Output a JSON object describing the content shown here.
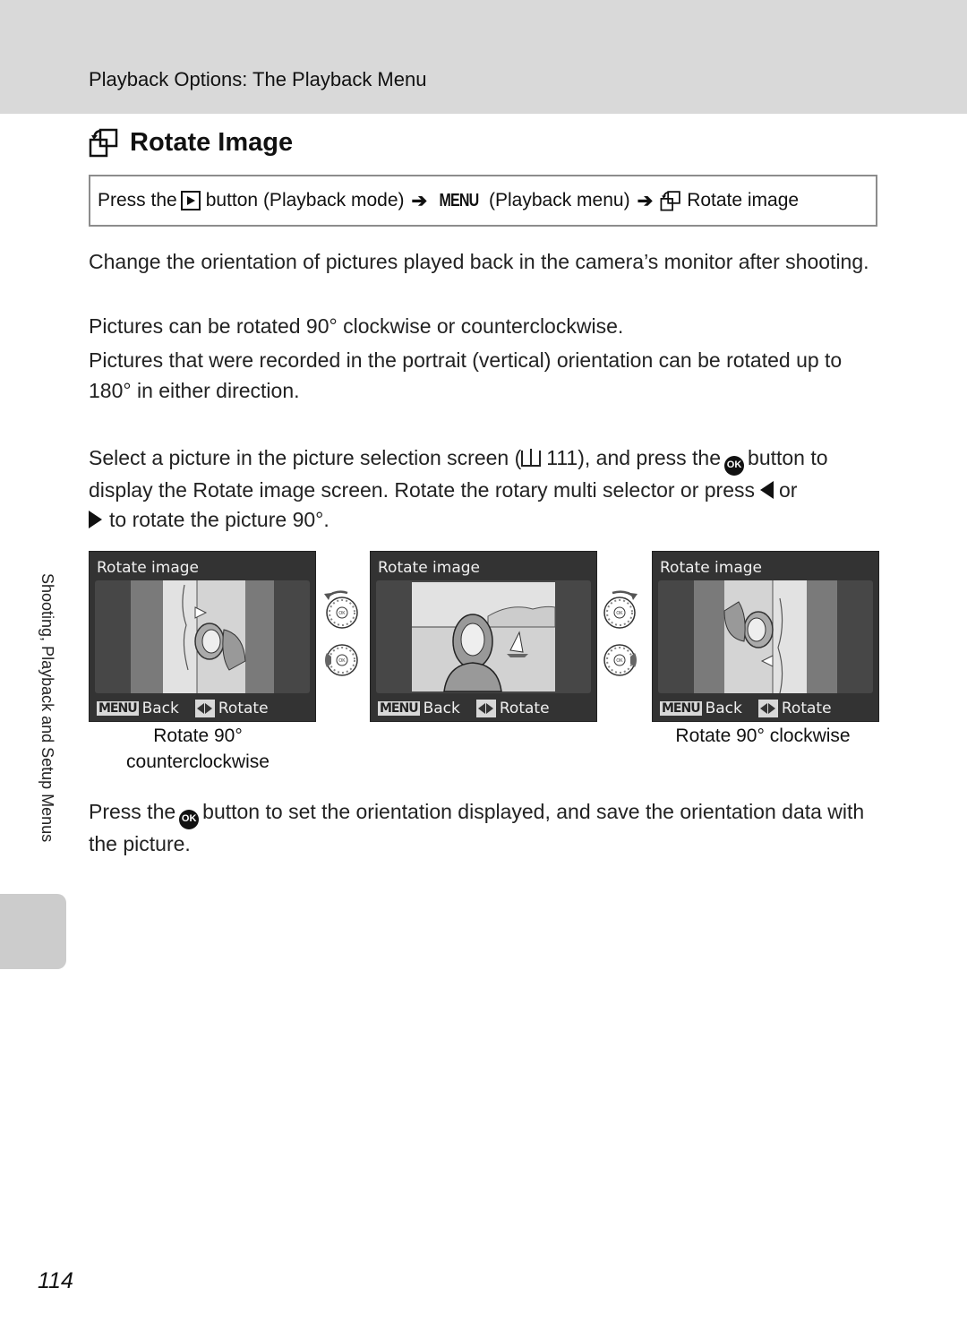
{
  "header": {
    "title": "Playback Options: The Playback Menu"
  },
  "section": {
    "icon": "rotate-image-icon",
    "title": "Rotate Image"
  },
  "nav_path": {
    "prefix": "Press the",
    "play_icon": "playback-button-icon",
    "step1": "button (Playback mode)",
    "arrow": "➔",
    "menu_glyph": "MENU",
    "step2": "(Playback menu)",
    "step3": "Rotate image"
  },
  "paragraphs": [
    "Change the orientation of pictures played back in the camera’s monitor after shooting.",
    "Pictures can be rotated 90° clockwise or counterclockwise.",
    "Pictures that were recorded in the portrait (vertical) orientation can be rotated up to 180° in either direction."
  ],
  "instruction": {
    "part1": "Select a picture in the picture selection screen (",
    "page_ref": "111), and press the",
    "ok_glyph": "OK",
    "part2": "button to display the Rotate image screen. Rotate the rotary multi selector or press",
    "or": "or",
    "part3": "to rotate the picture 90°."
  },
  "screens": [
    {
      "title": "Rotate image",
      "back_chip": "MENU",
      "back_label": "Back",
      "rotate_label": "Rotate",
      "orientation": "rotated-ccw"
    },
    {
      "title": "Rotate image",
      "back_chip": "MENU",
      "back_label": "Back",
      "rotate_label": "Rotate",
      "orientation": "original"
    },
    {
      "title": "Rotate image",
      "back_chip": "MENU",
      "back_label": "Back",
      "rotate_label": "Rotate",
      "orientation": "rotated-cw"
    }
  ],
  "captions": {
    "left_line1": "Rotate 90°",
    "left_line2": "counterclockwise",
    "right": "Rotate 90° clockwise"
  },
  "closing": {
    "part1": "Press the",
    "ok_glyph": "OK",
    "part2": "button to set the orientation displayed, and save the orientation data with the picture."
  },
  "sidebar": {
    "label": "Shooting, Playback and Setup Menus"
  },
  "page_number": "114"
}
